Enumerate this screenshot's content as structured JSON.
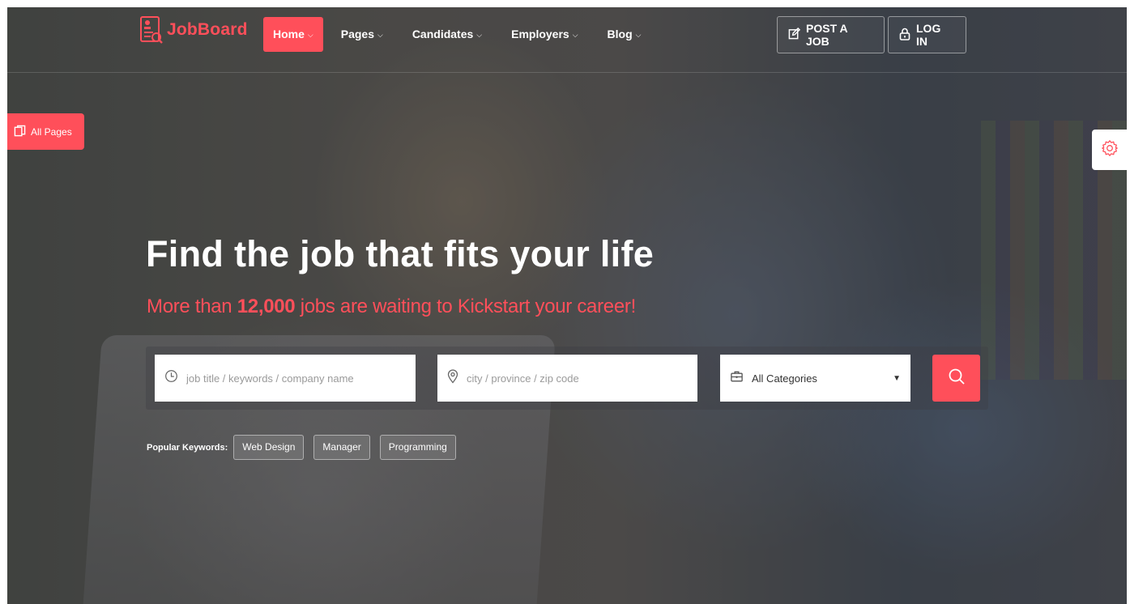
{
  "brand": {
    "name": "JobBoard",
    "accent_color": "#ff4f5a"
  },
  "nav": {
    "items": [
      {
        "label": "Home",
        "active": true
      },
      {
        "label": "Pages",
        "active": false
      },
      {
        "label": "Candidates",
        "active": false
      },
      {
        "label": "Employers",
        "active": false
      },
      {
        "label": "Blog",
        "active": false
      }
    ],
    "post_job_label": "POST A JOB",
    "login_label": "LOG IN"
  },
  "side": {
    "all_pages_label": "All Pages",
    "settings_icon": "gear-icon"
  },
  "hero": {
    "title": "Find the job that fits your life",
    "subtitle_prefix": "More than ",
    "subtitle_count": "12,000",
    "subtitle_suffix": " jobs are waiting to Kickstart your career!"
  },
  "search": {
    "keyword_placeholder": "job title / keywords / company name",
    "location_placeholder": "city / province / zip code",
    "category_value": "All Categories"
  },
  "keywords": {
    "label": "Popular Keywords:",
    "items": [
      "Web Design",
      "Manager",
      "Programming"
    ]
  }
}
